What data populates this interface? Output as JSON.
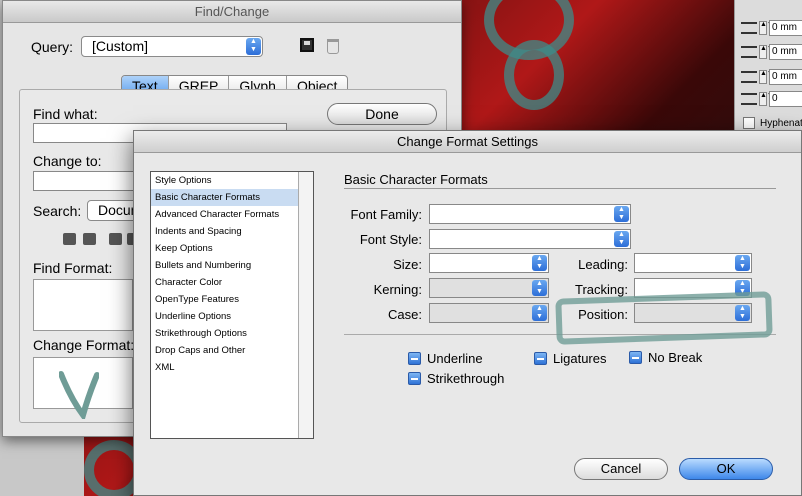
{
  "para_panel": {
    "fields": [
      "0 mm",
      "0 mm",
      "0 mm",
      "0"
    ],
    "hyphenate_label": "Hyphenate"
  },
  "find_change": {
    "title": "Find/Change",
    "query_label": "Query:",
    "query_value": "[Custom]",
    "tabs": [
      "Text",
      "GREP",
      "Glyph",
      "Object"
    ],
    "active_tab": "Text",
    "find_what_label": "Find what:",
    "change_to_label": "Change to:",
    "search_label": "Search:",
    "search_value": "Docum",
    "find_format_label": "Find Format:",
    "change_format_label": "Change Format:",
    "done_label": "Done"
  },
  "change_format": {
    "title": "Change Format Settings",
    "categories": [
      "Style Options",
      "Basic Character Formats",
      "Advanced Character Formats",
      "Indents and Spacing",
      "Keep Options",
      "Bullets and Numbering",
      "Character Color",
      "OpenType Features",
      "Underline Options",
      "Strikethrough Options",
      "Drop Caps and Other",
      "XML"
    ],
    "selected_category": "Basic Character Formats",
    "section_title": "Basic Character Formats",
    "labels": {
      "font_family": "Font Family:",
      "font_style": "Font Style:",
      "size": "Size:",
      "leading": "Leading:",
      "kerning": "Kerning:",
      "tracking": "Tracking:",
      "case": "Case:",
      "position": "Position:"
    },
    "checkboxes": {
      "underline": "Underline",
      "ligatures": "Ligatures",
      "no_break": "No Break",
      "strikethrough": "Strikethrough"
    },
    "cancel_label": "Cancel",
    "ok_label": "OK"
  }
}
